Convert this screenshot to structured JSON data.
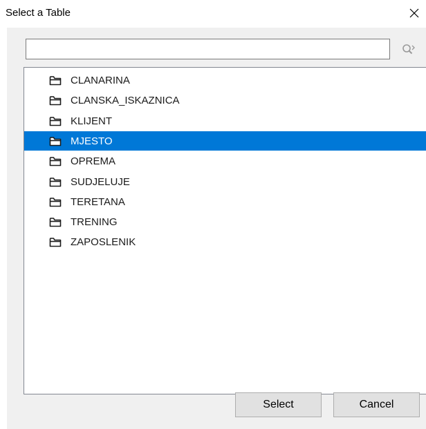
{
  "window": {
    "title": "Select a Table"
  },
  "search": {
    "value": "",
    "placeholder": ""
  },
  "icons": {
    "close": "close-icon",
    "search": "search-icon",
    "folder": "folder-icon"
  },
  "colors": {
    "selection": "#0078d7",
    "dialog_bg": "#f0f0f0"
  },
  "tables": [
    {
      "label": "CLANARINA",
      "selected": false
    },
    {
      "label": "CLANSKA_ISKAZNICA",
      "selected": false
    },
    {
      "label": "KLIJENT",
      "selected": false
    },
    {
      "label": "MJESTO",
      "selected": true
    },
    {
      "label": "OPREMA",
      "selected": false
    },
    {
      "label": "SUDJELUJE",
      "selected": false
    },
    {
      "label": "TERETANA",
      "selected": false
    },
    {
      "label": "TRENING",
      "selected": false
    },
    {
      "label": "ZAPOSLENIK",
      "selected": false
    }
  ],
  "buttons": {
    "select_label": "Select",
    "cancel_label": "Cancel"
  }
}
